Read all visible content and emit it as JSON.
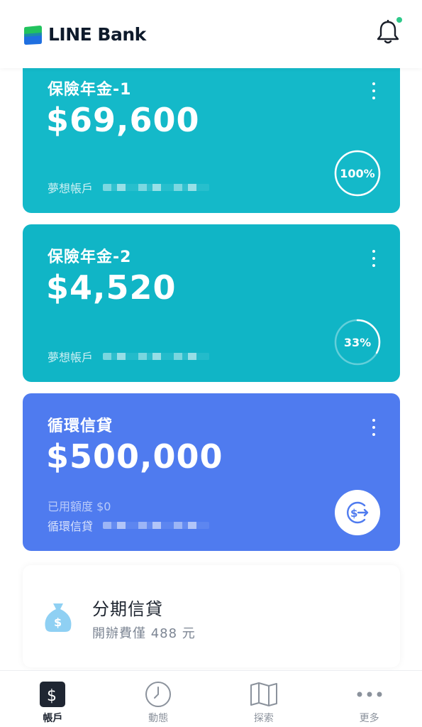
{
  "app": {
    "brand": "LINE Bank",
    "colors": {
      "teal_card": "#14b9c9",
      "teal_card_2": "#10b5c6",
      "blue_card": "#4f7bef",
      "notification_dot": "#2ec98a",
      "logo_green": "#22c35e",
      "logo_blue": "#1f6fe0"
    }
  },
  "header": {
    "notification_icon": "bell-icon",
    "has_notification": true
  },
  "cards": [
    {
      "title": "保險年金-1",
      "amount": "$69,600",
      "account_label": "夢想帳戶",
      "progress_label": "100%",
      "progress_value": 1.0
    },
    {
      "title": "保險年金-2",
      "amount": "$4,520",
      "account_label": "夢想帳戶",
      "progress_label": "33%",
      "progress_value": 0.33
    },
    {
      "title": "循環信貸",
      "amount": "$500,000",
      "used_label": "已用額度 $0",
      "account_label": "循環信貸",
      "action_icon": "dollar-transfer-icon"
    }
  ],
  "installment": {
    "title": "分期信貸",
    "subtitle": "開辦費僅 488 元",
    "icon": "money-bag-icon"
  },
  "tabbar": {
    "items": [
      {
        "label": "帳戶",
        "icon": "dollar-square-icon",
        "active": true
      },
      {
        "label": "動態",
        "icon": "clock-icon",
        "active": false
      },
      {
        "label": "探索",
        "icon": "map-icon",
        "active": false
      },
      {
        "label": "更多",
        "icon": "more-dots-icon",
        "active": false
      }
    ]
  }
}
